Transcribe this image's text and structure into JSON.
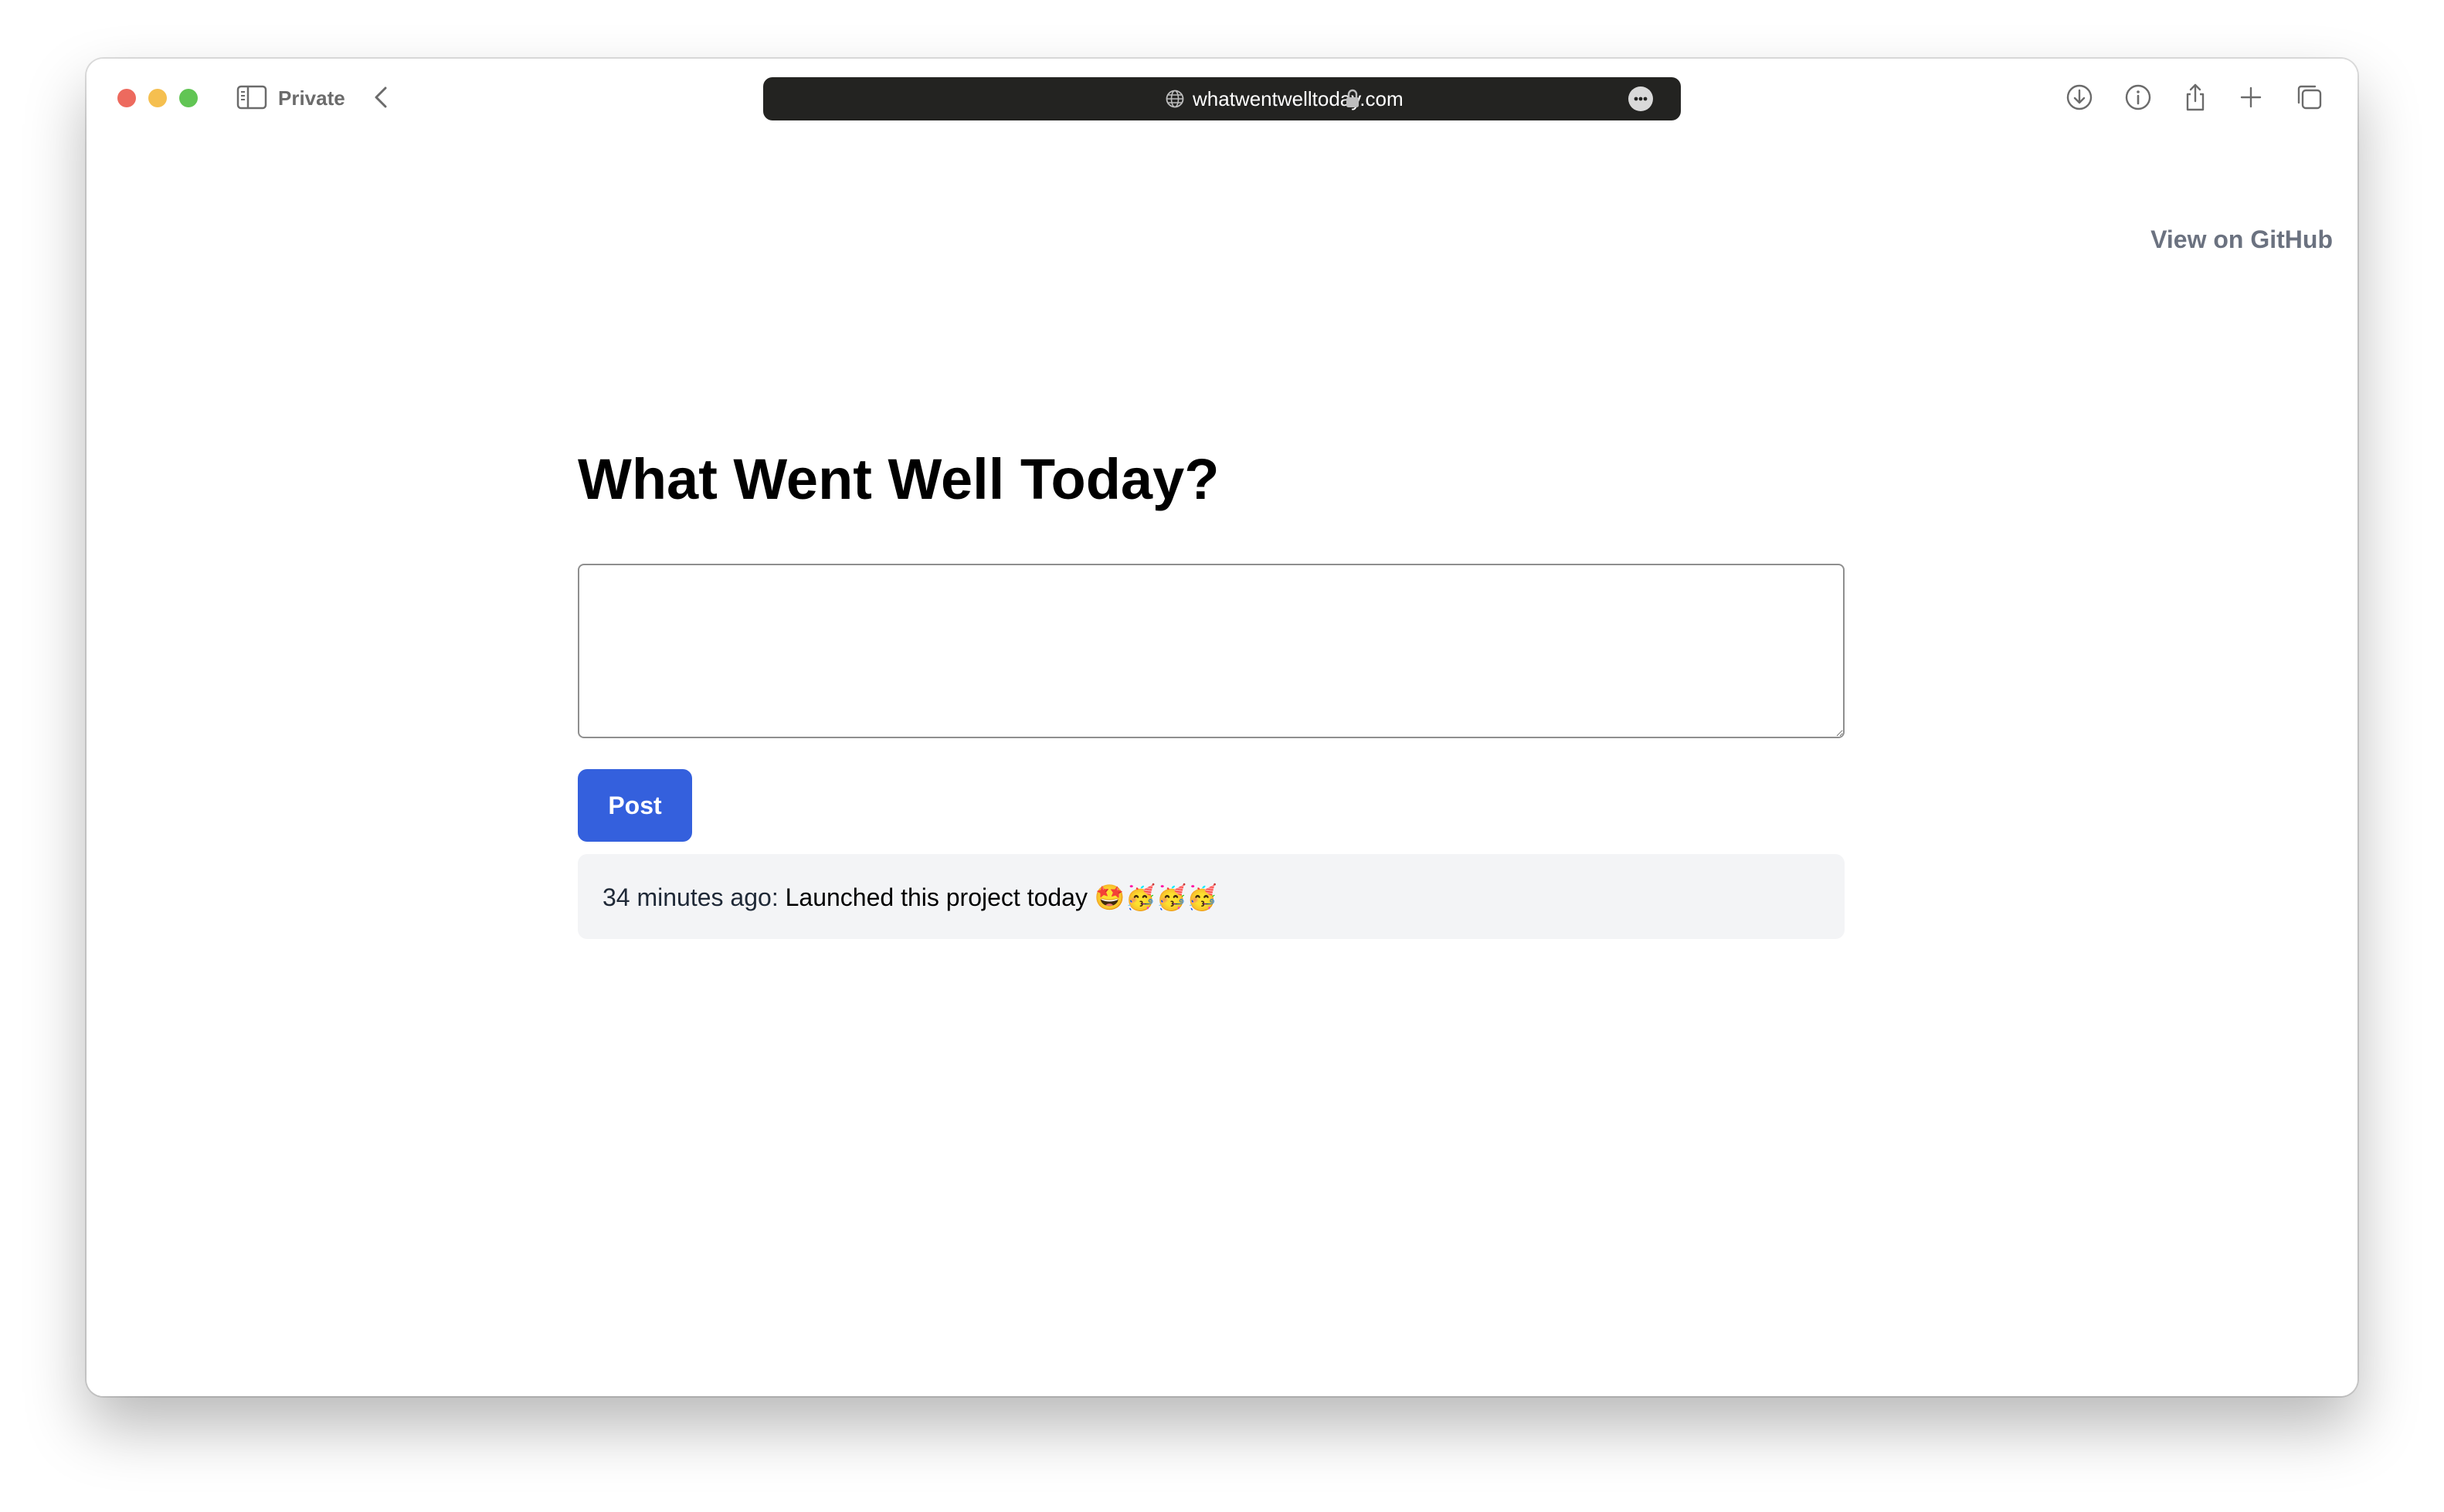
{
  "browser": {
    "mode_label": "Private",
    "url": "whatwentwelltoday.com"
  },
  "header": {
    "github_link": "View on GitHub"
  },
  "main": {
    "title": "What Went Well Today?",
    "input": {
      "value": "",
      "placeholder": ""
    },
    "post_button": "Post",
    "posts": [
      {
        "time": "34 minutes ago:",
        "message": "Launched this project today 🤩🥳🥳🥳"
      }
    ]
  },
  "colors": {
    "accent": "#3460dd",
    "card_bg": "#f3f4f6",
    "link": "#6b7280",
    "urlbar_bg": "#232321"
  },
  "icons": {
    "toolbar_right": [
      "download-icon",
      "info-icon",
      "share-icon",
      "new-tab-icon",
      "tab-overview-icon"
    ]
  }
}
